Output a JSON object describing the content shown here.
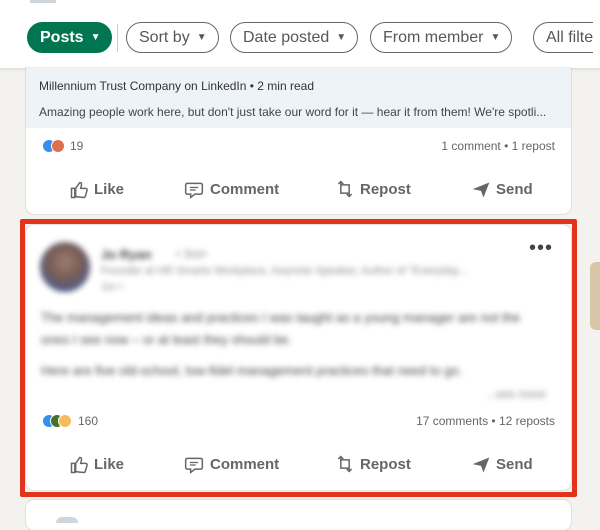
{
  "filters": {
    "posts_label": "Posts",
    "sort_label": "Sort by",
    "date_label": "Date posted",
    "member_label": "From member",
    "all_label": "All filte"
  },
  "post1": {
    "article_source": "Millennium Trust Company on LinkedIn • 2 min read",
    "article_snippet": "Amazing people work here, but don't just take our word for it — hear it from them! We're spotli...",
    "reaction_count": "19",
    "engagement": "1 comment • 1 repost"
  },
  "post2": {
    "author_name": "Jo Ryan",
    "author_degree": "• 3rd+",
    "author_headline": "Founder at HR Smarts Workplace, Keynote Speaker, Author of \"Everyday...",
    "time": "1w •",
    "paragraph1": "The management ideas and practices I was taught as a young manager are not the ones I see now – or at least they should be.",
    "paragraph2": "Here are five old-school, low-fidel management practices that need to go.",
    "see_more": "...see more",
    "reaction_count": "160",
    "engagement": "17 comments • 12 reposts"
  },
  "actions": {
    "like": "Like",
    "comment": "Comment",
    "repost": "Repost",
    "send": "Send"
  },
  "colors": {
    "accent_green": "#01754f",
    "highlight_red": "#e2341d",
    "like_blue": "#378fe9",
    "love_red": "#df704d",
    "celebrate_green": "#44712e",
    "insight_yellow": "#f5bb5c"
  }
}
